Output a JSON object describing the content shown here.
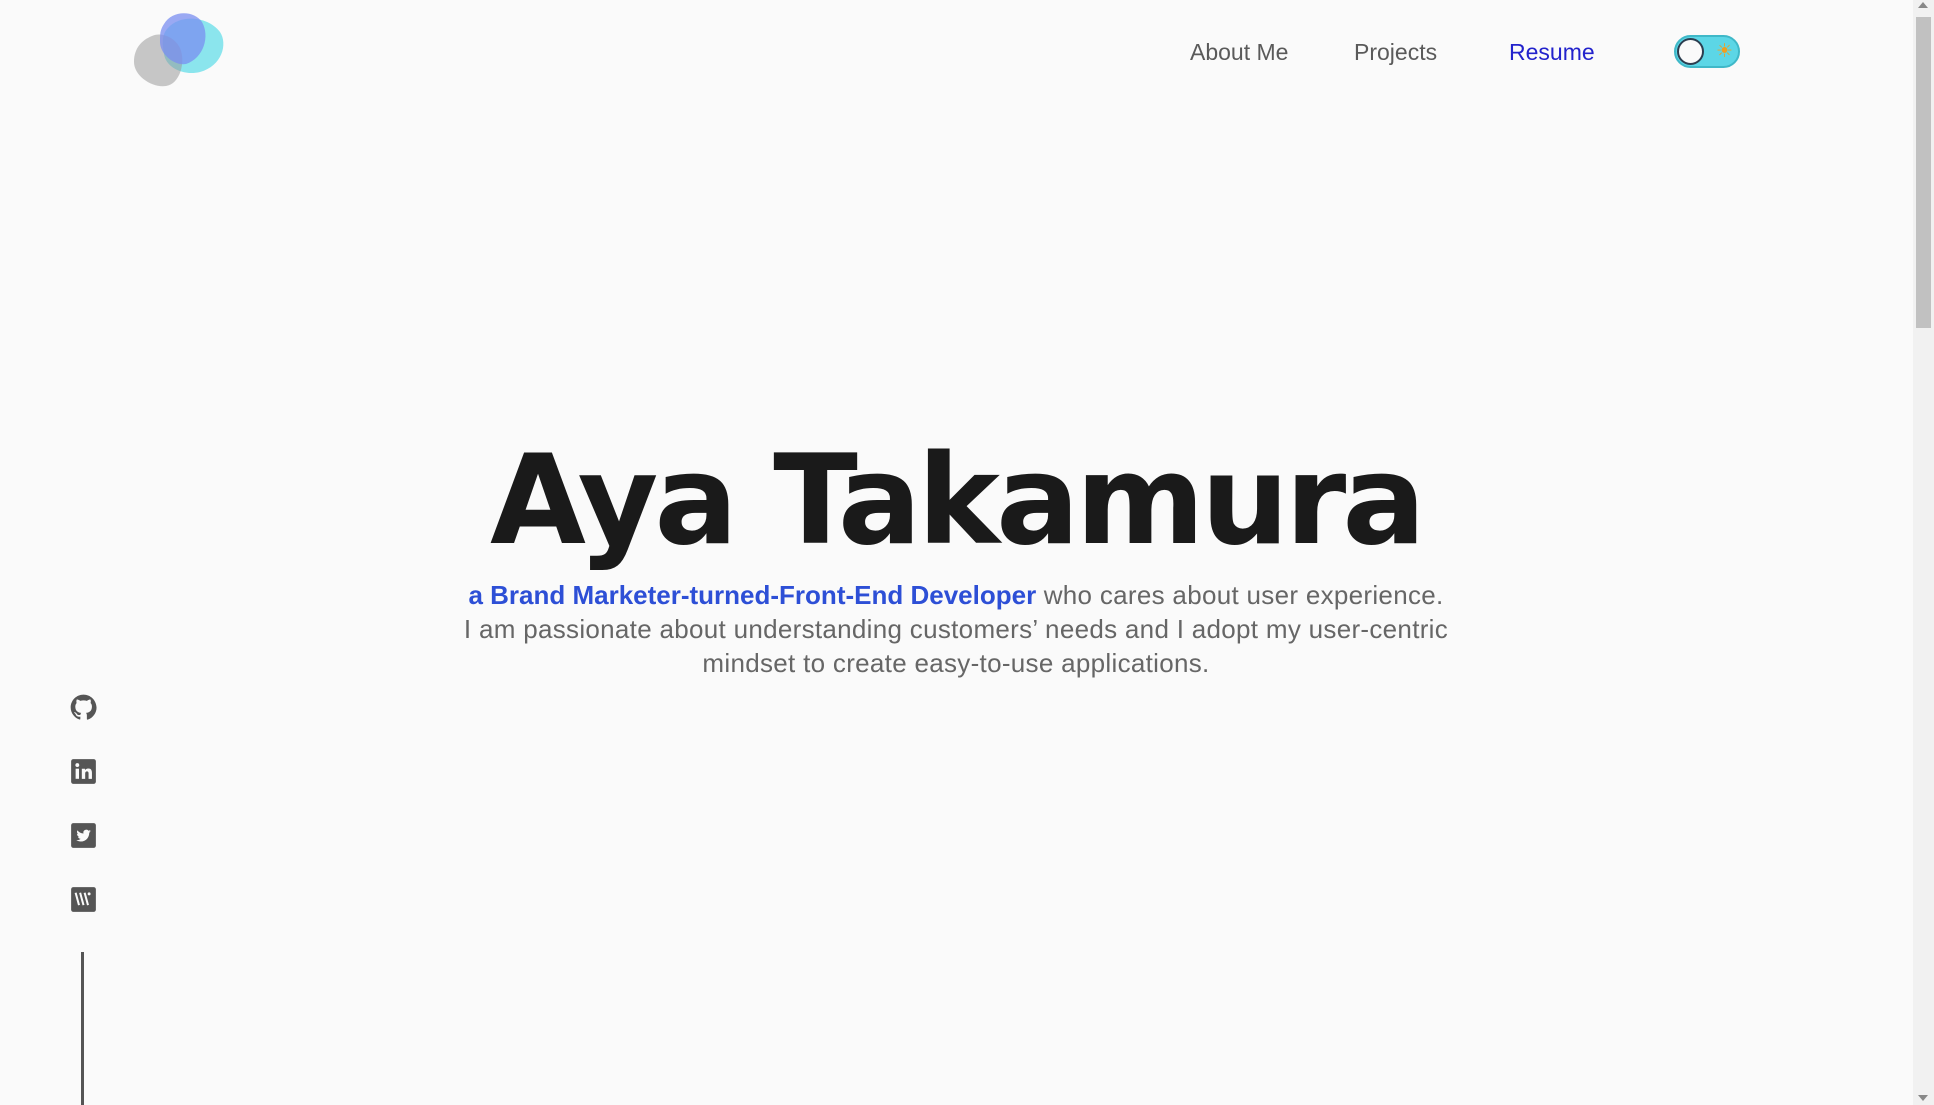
{
  "nav": {
    "logo_icon": "blob-logo-icon",
    "items": [
      {
        "label": "About Me"
      },
      {
        "label": "Projects"
      },
      {
        "label": "Resume"
      }
    ],
    "theme_toggle_icon": "sun-icon",
    "theme_toggle_glyph": "☀"
  },
  "hero": {
    "name": "Aya Takamura",
    "highlight": "a Brand Marketer-turned-Front-End Developer",
    "text_1": " who cares about user experience.",
    "text_2": "I am passionate about understanding customers’ needs and I adopt my user-centric mindset to create easy-to-use applications."
  },
  "social": [
    {
      "icon": "github-icon"
    },
    {
      "icon": "linkedin-icon"
    },
    {
      "icon": "twitter-icon"
    },
    {
      "icon": "wantedly-icon"
    }
  ],
  "colors": {
    "background": "#fafafa",
    "accent": "#2d4fd6",
    "resume_link": "#2222cc",
    "toggle": "#5cd6e6",
    "title": "#1a1a1a"
  }
}
